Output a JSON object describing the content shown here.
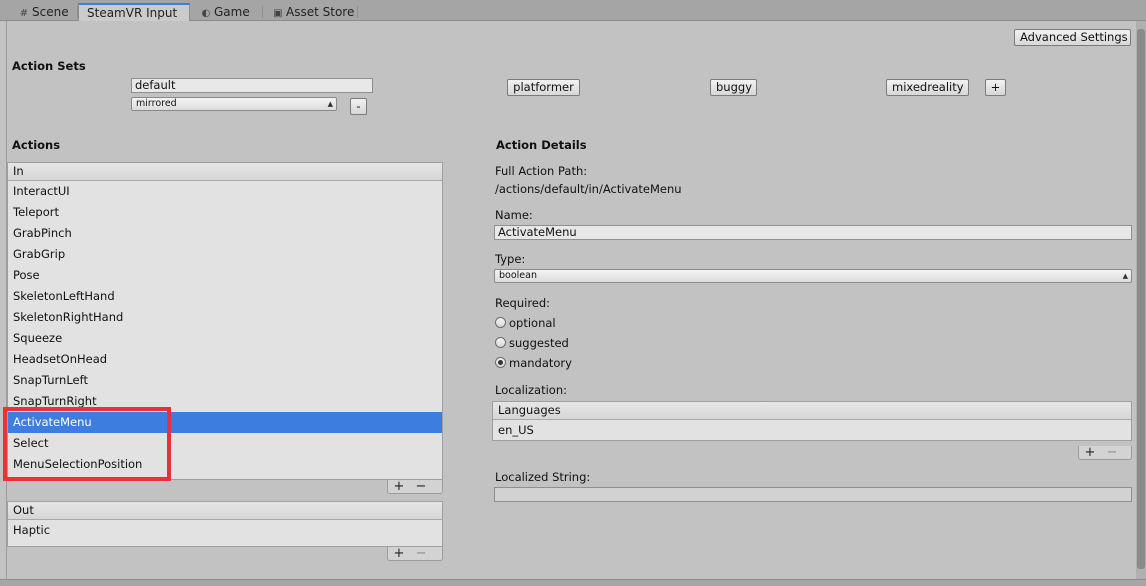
{
  "tabs": [
    {
      "icon": "#",
      "label": "Scene"
    },
    {
      "icon": "",
      "label": "SteamVR Input"
    },
    {
      "icon": "◐",
      "label": "Game"
    },
    {
      "icon": "▣",
      "label": "Asset Store"
    }
  ],
  "toolbar": {
    "advanced_label": "Advanced Settings"
  },
  "action_sets": {
    "title": "Action Sets",
    "name_value": "default",
    "usage_value": "mirrored",
    "remove_label": "-",
    "add_label": "+",
    "sets": [
      "platformer",
      "buggy",
      "mixedreality"
    ]
  },
  "actions": {
    "title": "Actions",
    "in_header": "In",
    "in_items": [
      "InteractUI",
      "Teleport",
      "GrabPinch",
      "GrabGrip",
      "Pose",
      "SkeletonLeftHand",
      "SkeletonRightHand",
      "Squeeze",
      "HeadsetOnHead",
      "SnapTurnLeft",
      "SnapTurnRight",
      "ActivateMenu",
      "Select",
      "MenuSelectionPosition"
    ],
    "selected": "ActivateMenu",
    "out_header": "Out",
    "out_items": [
      "Haptic"
    ],
    "plus": "+",
    "minus": "−"
  },
  "details": {
    "title": "Action Details",
    "path_label": "Full Action Path:",
    "path_value": "/actions/default/in/ActivateMenu",
    "name_label": "Name:",
    "name_value": "ActivateMenu",
    "type_label": "Type:",
    "type_value": "boolean",
    "required_label": "Required:",
    "required_options": [
      "optional",
      "suggested",
      "mandatory"
    ],
    "required_selected": "mandatory",
    "localization_label": "Localization:",
    "languages_header": "Languages",
    "languages": [
      "en_US"
    ],
    "localized_string_label": "Localized String:",
    "localized_string_value": ""
  },
  "colors": {
    "selection": "#3e7de0",
    "highlight": "#e8313a",
    "active_tab_accent": "#3c7fd8"
  }
}
